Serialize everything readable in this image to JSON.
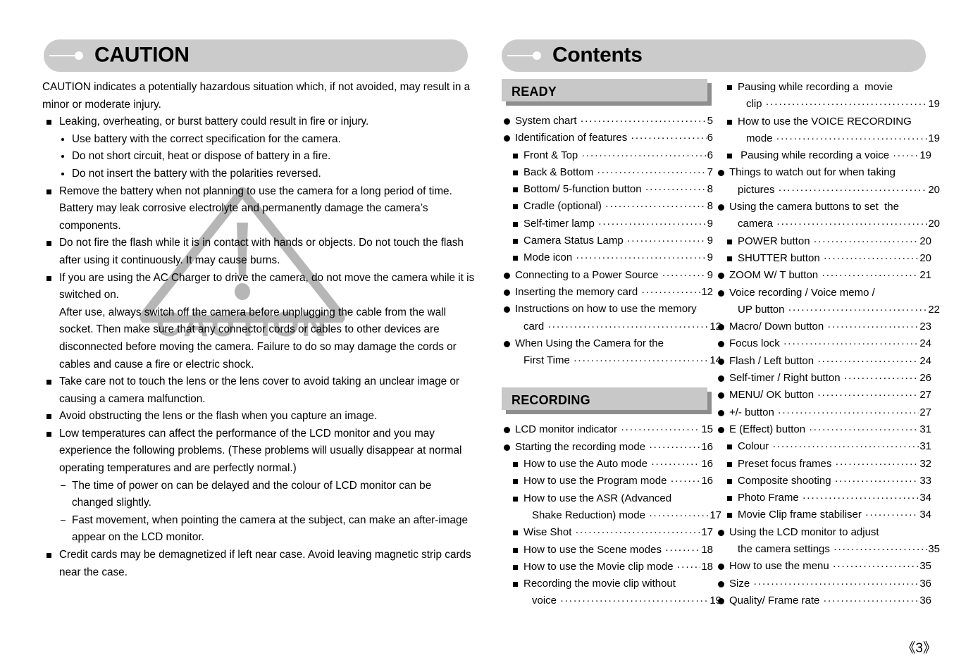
{
  "page": {
    "folio": "《3》"
  },
  "left": {
    "banner_title": "CAUTION",
    "intro": "CAUTION indicates a potentially hazardous situation which, if not avoided, may result in a minor or moderate injury.",
    "items": [
      {
        "type": "square",
        "text": "Leaking, overheating, or burst battery could result in fire or injury."
      },
      {
        "type": "dot",
        "text": "Use battery with the correct specification for the camera."
      },
      {
        "type": "dot",
        "text": "Do not short circuit, heat or dispose of battery in a fire."
      },
      {
        "type": "dot",
        "text": "Do not insert the battery with the polarities reversed."
      },
      {
        "type": "square",
        "text": "Remove the battery when not planning to use the camera for a long period of time. Battery may leak corrosive electrolyte and permanently damage the camera’s components."
      },
      {
        "type": "square",
        "text": "Do not fire the flash while it is in contact with hands or objects. Do not touch the flash after using it continuously. It may cause burns."
      },
      {
        "type": "square",
        "text": "If you are using the AC Charger to drive the camera, do not move the camera while it is switched on."
      },
      {
        "type": "cont",
        "text": "After use, always switch off the camera before unplugging the cable from the wall socket. Then make sure that any connector cords or cables to other devices are disconnected before moving the camera. Failure to do so may damage the cords or cables and cause a fire or electric shock."
      },
      {
        "type": "square",
        "text": "Take care not to touch the lens or the lens cover to avoid taking an unclear image or causing a camera malfunction."
      },
      {
        "type": "square",
        "text": "Avoid obstructing the lens or the flash when you capture an image."
      },
      {
        "type": "square",
        "text": "Low temperatures can affect the performance of the LCD monitor and you may experience the following problems. (These problems will usually disappear at normal operating temperatures and are perfectly normal.)"
      },
      {
        "type": "dash",
        "text": "The time of power on can be delayed and the colour of LCD monitor can be changed slightly."
      },
      {
        "type": "dash",
        "text": "Fast movement, when pointing the camera at the subject, can make an after-image appear on the LCD monitor."
      },
      {
        "type": "square",
        "text": "Credit cards may be demagnetized if left near case. Avoid leaving magnetic strip cards near the case."
      }
    ],
    "watermark_word": "CAUTION"
  },
  "right": {
    "banner_title": "Contents",
    "sections": [
      {
        "id": "ready",
        "label": "READY"
      },
      {
        "id": "recording",
        "label": "RECORDING"
      }
    ],
    "column_a": [
      {
        "kind": "section",
        "label": "READY"
      },
      {
        "kind": "entry",
        "level": 1,
        "label": "System chart",
        "page": "5"
      },
      {
        "kind": "entry",
        "level": 1,
        "label": "Identification of features",
        "page": "6"
      },
      {
        "kind": "entry",
        "level": 2,
        "label": "Front & Top",
        "page": "6"
      },
      {
        "kind": "entry",
        "level": 2,
        "label": "Back & Bottom",
        "page": "7"
      },
      {
        "kind": "entry",
        "level": 2,
        "label": "Bottom/ 5-function button",
        "page": "8"
      },
      {
        "kind": "entry",
        "level": 2,
        "label": "Cradle (optional)",
        "page": "8"
      },
      {
        "kind": "entry",
        "level": 2,
        "label": "Self-timer lamp",
        "page": "9"
      },
      {
        "kind": "entry",
        "level": 2,
        "label": "Camera Status Lamp",
        "page": "9"
      },
      {
        "kind": "entry",
        "level": 2,
        "label": "Mode icon",
        "page": "9"
      },
      {
        "kind": "entry",
        "level": 1,
        "label": "Connecting to a Power Source",
        "page": "9"
      },
      {
        "kind": "entry",
        "level": 1,
        "label": "Inserting the memory card",
        "page": "12"
      },
      {
        "kind": "entry2",
        "level": 1,
        "label": "Instructions on how to use the memory",
        "label2": "card",
        "page": "12"
      },
      {
        "kind": "entry2",
        "level": 1,
        "label": "When Using the Camera for the",
        "label2": "First Time",
        "page": "14"
      },
      {
        "kind": "section",
        "label": "RECORDING"
      },
      {
        "kind": "entry",
        "level": 1,
        "label": "LCD monitor indicator",
        "page": "15"
      },
      {
        "kind": "entry",
        "level": 1,
        "label": "Starting the recording mode",
        "page": "16"
      },
      {
        "kind": "entry",
        "level": 2,
        "label": "How to use the Auto mode",
        "page": "16"
      },
      {
        "kind": "entry",
        "level": 2,
        "label": "How to use the Program mode",
        "page": "16"
      },
      {
        "kind": "entry2",
        "level": 2,
        "label": "How to use the ASR (Advanced",
        "label2": "Shake Reduction) mode",
        "page": "17"
      },
      {
        "kind": "entry",
        "level": 2,
        "label": "Wise Shot",
        "page": "17"
      },
      {
        "kind": "entry",
        "level": 2,
        "label": "How to use the Scene modes",
        "page": "18"
      },
      {
        "kind": "entry",
        "level": 2,
        "label": "How to use the Movie clip mode",
        "page": "18"
      },
      {
        "kind": "entry2",
        "level": 2,
        "label": "Recording the movie clip without",
        "label2": "voice",
        "page": "19"
      }
    ],
    "column_b": [
      {
        "kind": "entry2",
        "level": 2,
        "label": "Pausing while recording a  movie",
        "label2": "clip",
        "page": "19"
      },
      {
        "kind": "entry2",
        "level": 2,
        "label": "How to use the VOICE RECORDING",
        "label2": "mode",
        "page": "19"
      },
      {
        "kind": "entry",
        "level": 2,
        "label": " Pausing while recording a voice",
        "page": "19"
      },
      {
        "kind": "entry2",
        "level": 1,
        "label": "Things to watch out for when taking",
        "label2": "pictures",
        "page": "20"
      },
      {
        "kind": "entry2",
        "level": 1,
        "label": "Using the camera buttons to set  the",
        "label2": "camera",
        "page": "20"
      },
      {
        "kind": "entry",
        "level": 2,
        "label": "POWER button",
        "page": "20"
      },
      {
        "kind": "entry",
        "level": 2,
        "label": "SHUTTER button",
        "page": "20"
      },
      {
        "kind": "entry",
        "level": 1,
        "label": "ZOOM W/ T button",
        "page": "21"
      },
      {
        "kind": "entry2",
        "level": 1,
        "label": "Voice recording / Voice memo /",
        "label2": "UP button",
        "page": "22"
      },
      {
        "kind": "entry",
        "level": 1,
        "label": "Macro/ Down button",
        "page": "23"
      },
      {
        "kind": "entry",
        "level": 1,
        "label": "Focus lock",
        "page": "24"
      },
      {
        "kind": "entry",
        "level": 1,
        "label": "Flash / Left button",
        "page": "24"
      },
      {
        "kind": "entry",
        "level": 1,
        "label": "Self-timer / Right button",
        "page": "26"
      },
      {
        "kind": "entry",
        "level": 1,
        "label": "MENU/ OK button",
        "page": "27"
      },
      {
        "kind": "entry",
        "level": 1,
        "label": "+/- button",
        "page": "27"
      },
      {
        "kind": "entry",
        "level": 1,
        "label": "E (Effect) button",
        "page": "31"
      },
      {
        "kind": "entry",
        "level": 2,
        "label": "Colour",
        "page": "31"
      },
      {
        "kind": "entry",
        "level": 2,
        "label": "Preset focus frames",
        "page": "32"
      },
      {
        "kind": "entry",
        "level": 2,
        "label": "Composite shooting",
        "page": "33"
      },
      {
        "kind": "entry",
        "level": 2,
        "label": "Photo Frame",
        "page": "34"
      },
      {
        "kind": "entry",
        "level": 2,
        "label": "Movie Clip frame stabiliser",
        "page": "34"
      },
      {
        "kind": "entry2",
        "level": 1,
        "label": "Using the LCD monitor to adjust",
        "label2": "the camera settings",
        "page": "35"
      },
      {
        "kind": "entry",
        "level": 1,
        "label": "How to use the menu",
        "page": "35"
      },
      {
        "kind": "entry",
        "level": 1,
        "label": "Size",
        "page": "36"
      },
      {
        "kind": "entry",
        "level": 1,
        "label": "Quality/ Frame rate",
        "page": "36"
      }
    ]
  },
  "colors": {
    "banner_bg": "#cbcbcb",
    "section_bg": "#c8c8c8",
    "section_shadow": "#8e8e8e",
    "watermark": "#b6b6b6",
    "text": "#000000"
  }
}
